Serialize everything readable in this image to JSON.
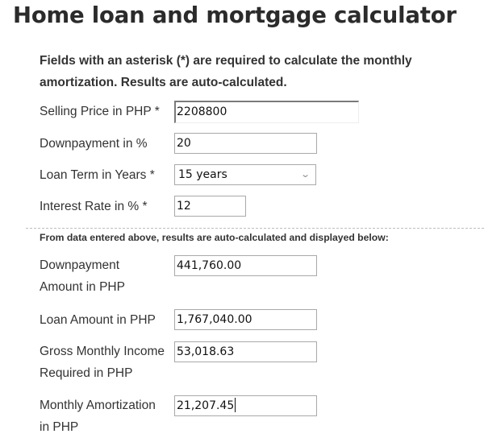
{
  "header": {
    "title": "Home loan and mortgage calculator"
  },
  "intro": {
    "text": "Fields with an asterisk (*) are required to calculate the monthly amortization. Results are auto-calculated."
  },
  "inputs": {
    "selling_price": {
      "label": "Selling Price in PHP *",
      "value": "2208800"
    },
    "downpayment_pct": {
      "label": "Downpayment in %",
      "value": "20"
    },
    "loan_term": {
      "label": "Loan Term in Years *",
      "value": "15 years",
      "icon": "chevron-down-icon"
    },
    "interest_rate": {
      "label": "Interest Rate in % *",
      "value": "12"
    }
  },
  "results_note": "From data entered above, results are auto-calculated and displayed below:",
  "results": {
    "downpayment_amount": {
      "label_line1": "Downpayment",
      "label_line2": "Amount in PHP",
      "value": "441,760.00"
    },
    "loan_amount": {
      "label": "Loan Amount in PHP",
      "value": "1,767,040.00"
    },
    "gross_income": {
      "label_line1": "Gross Monthly Income",
      "label_line2": "Required in PHP",
      "value": "53,018.63"
    },
    "monthly_amortization": {
      "label_line1": "Monthly Amortization",
      "label_line2": "in PHP",
      "value": "21,207.45"
    }
  }
}
